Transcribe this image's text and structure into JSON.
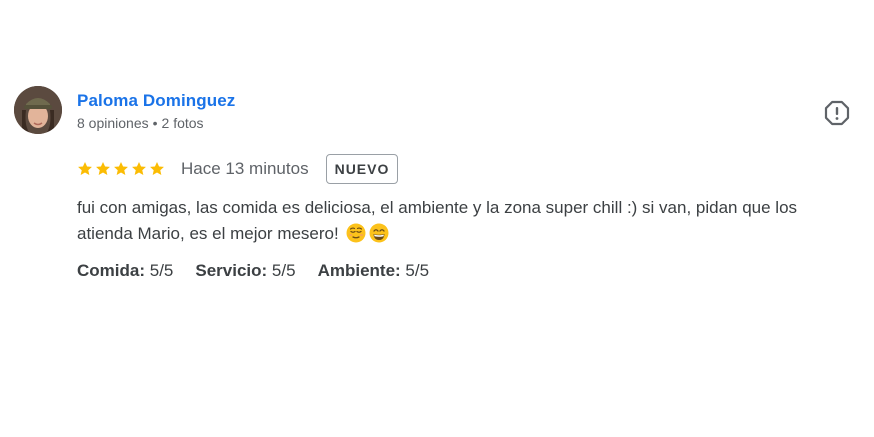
{
  "review": {
    "author": {
      "name": "Paloma Dominguez",
      "reviews_count": "8 opiniones",
      "separator": "•",
      "photos_count": "2 fotos"
    },
    "rating": 5,
    "rating_max": 5,
    "time": "Hace 13 minutos",
    "badge": "NUEVO",
    "text": "fui con amigas, las comida es deliciosa, el ambiente y la zona super chill :) si van, pidan que los atienda Mario, es el mejor mesero!",
    "emojis": [
      "relieved-face-icon",
      "grinning-face-icon"
    ],
    "attributes": [
      {
        "label": "Comida:",
        "value": "5/5"
      },
      {
        "label": "Servicio:",
        "value": "5/5"
      },
      {
        "label": "Ambiente:",
        "value": "5/5"
      }
    ]
  },
  "colors": {
    "author_link": "#1a73e8",
    "star": "#fbbc04",
    "meta_text": "#5f6368",
    "body_text": "#3c4043"
  }
}
